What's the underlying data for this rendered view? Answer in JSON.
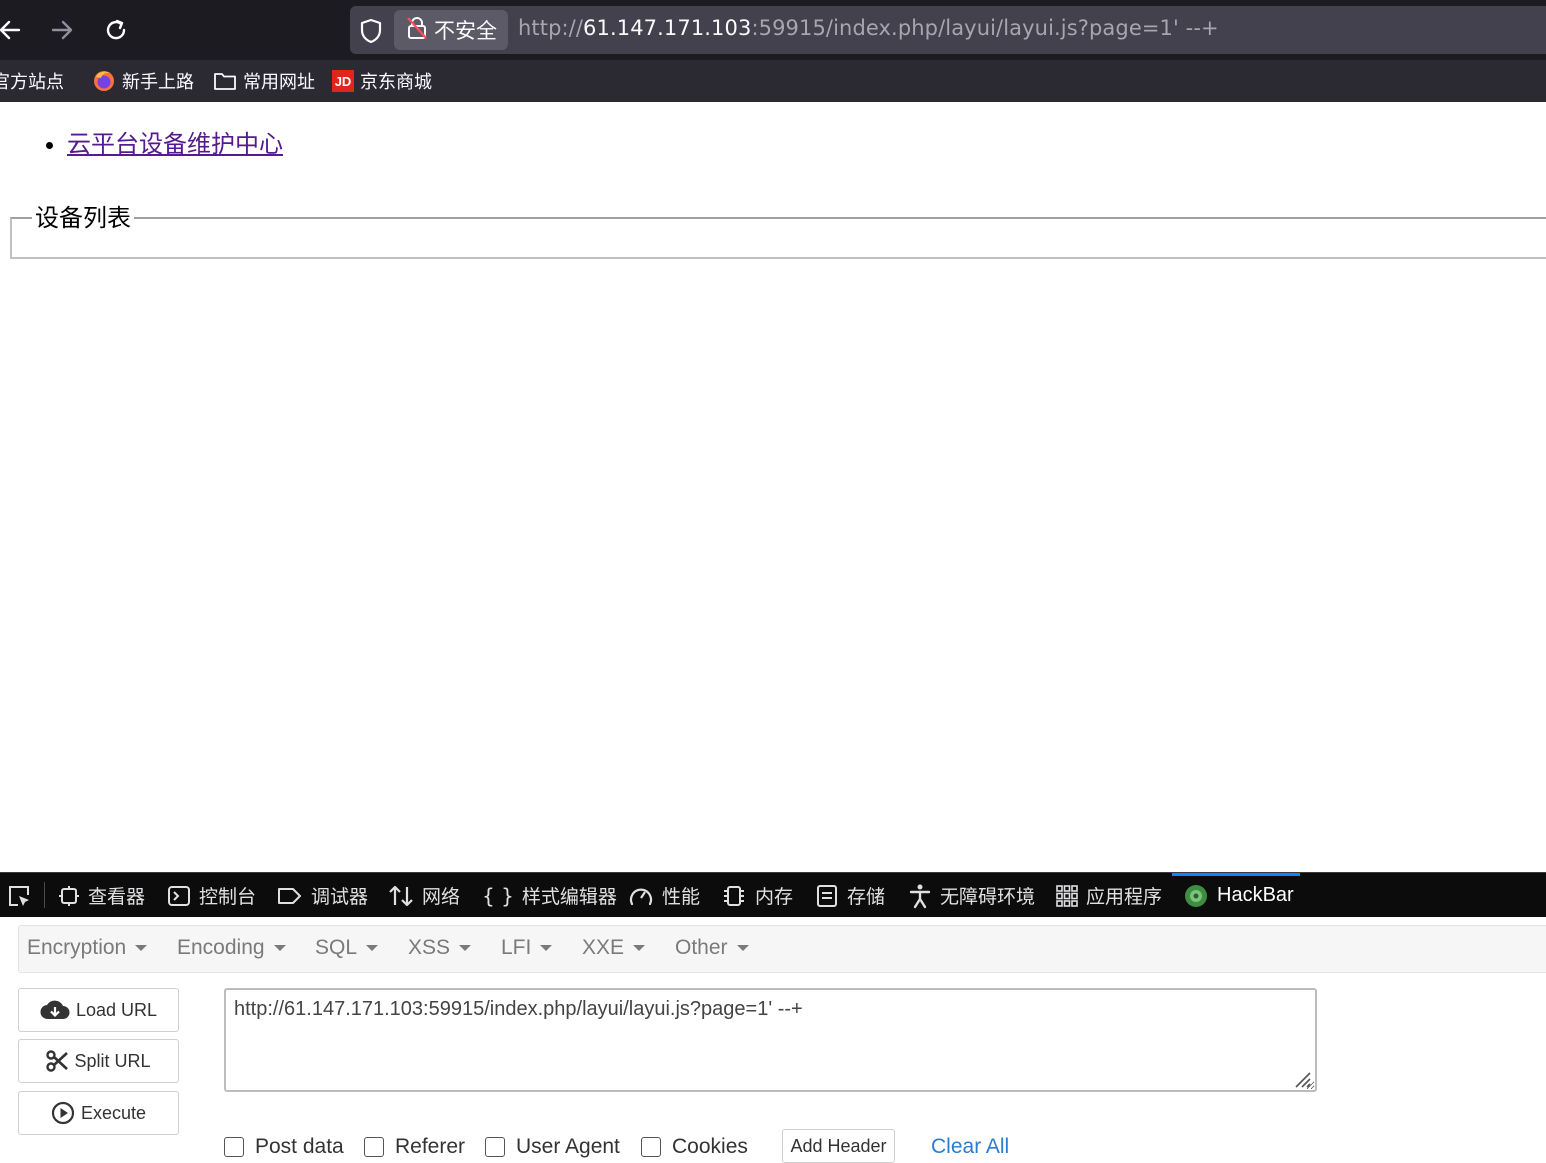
{
  "browser": {
    "security_label": "不安全",
    "url_scheme": "http://",
    "url_host": "61.147.171.103",
    "url_rest": ":59915/index.php/layui/layui.js?page=1' --+"
  },
  "bookmarks": [
    {
      "label": "官方站点",
      "icon": "firefox-icon-partial"
    },
    {
      "label": "新手上路",
      "icon": "firefox-icon"
    },
    {
      "label": "常用网址",
      "icon": "folder-icon"
    },
    {
      "label": "京东商城",
      "icon": "jd-icon",
      "badge": "JD"
    }
  ],
  "page": {
    "link": "云平台设备维护中心",
    "legend": "设备列表"
  },
  "devtools": {
    "tabs": [
      {
        "label": "查看器",
        "icon": "inspector-icon"
      },
      {
        "label": "控制台",
        "icon": "console-icon"
      },
      {
        "label": "调试器",
        "icon": "debugger-icon"
      },
      {
        "label": "网络",
        "icon": "network-icon"
      },
      {
        "label": "样式编辑器",
        "icon": "style-editor-icon"
      },
      {
        "label": "性能",
        "icon": "performance-icon"
      },
      {
        "label": "内存",
        "icon": "memory-icon"
      },
      {
        "label": "存储",
        "icon": "storage-icon"
      },
      {
        "label": "无障碍环境",
        "icon": "accessibility-icon"
      },
      {
        "label": "应用程序",
        "icon": "application-icon"
      },
      {
        "label": "HackBar",
        "icon": "hackbar-icon"
      }
    ],
    "active_tab": "HackBar",
    "accent_color": "#0a84ff"
  },
  "hackbar": {
    "menu": [
      "Encryption",
      "Encoding",
      "SQL",
      "XSS",
      "LFI",
      "XXE",
      "Other"
    ],
    "buttons": {
      "load": "Load URL",
      "split": "Split URL",
      "execute": "Execute"
    },
    "url_value": "http://61.147.171.103:59915/index.php/layui/layui.js?page=1' --+",
    "options": {
      "post": "Post data",
      "referer": "Referer",
      "user_agent": "User Agent",
      "cookies": "Cookies"
    },
    "add_header": "Add Header",
    "clear_all": "Clear All"
  }
}
